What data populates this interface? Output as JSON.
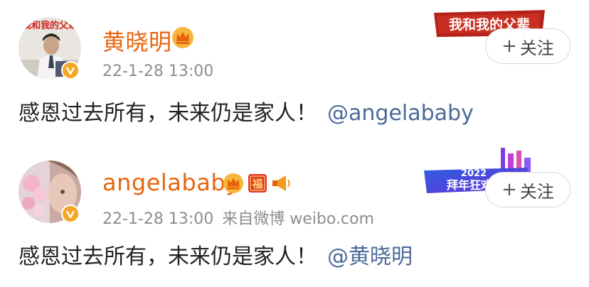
{
  "posts": [
    {
      "username": "黄晓明",
      "timestamp": "22-1-28 13:00",
      "source": "",
      "content": "感恩过去所有，未来仍是家人！",
      "mention": "@angelababy",
      "follow_label": "关注",
      "follow_plus": "+",
      "avatar_caption": "我和我的父辈",
      "banner_text": "我和我的父辈"
    },
    {
      "username": "angelababy",
      "timestamp": "22-1-28 13:00",
      "source": "来自微博 weibo.com",
      "content": "感恩过去所有，未来仍是家人！",
      "mention": "@黄晓明",
      "follow_label": "关注",
      "follow_plus": "+",
      "fu_badge": "福",
      "banner_year": "2022",
      "banner_text": "拜年狂欢节"
    }
  ],
  "colors": {
    "username": "#e8640c",
    "mention": "#4b6b9a",
    "meta": "#8d8d8d",
    "verify": "#f5a623"
  }
}
